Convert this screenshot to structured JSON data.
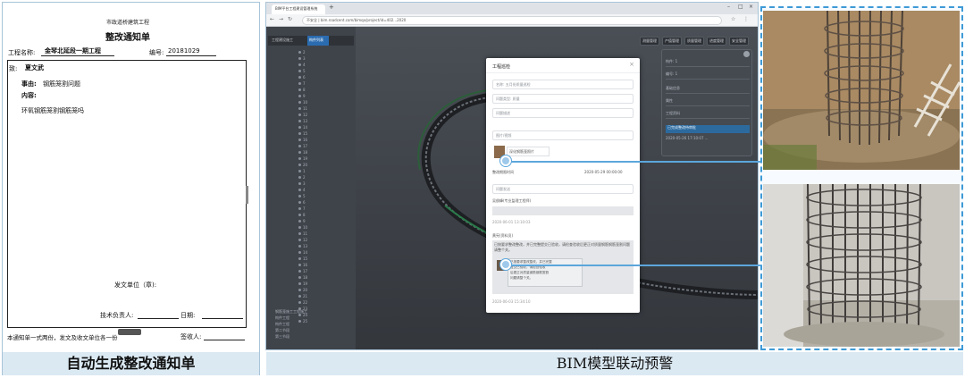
{
  "notice": {
    "header_small": "市政道桥建筑工程",
    "title": "整改通知单",
    "project_label": "工程名称:",
    "project_name": "金琴北延段一期工程",
    "number_label": "编号:",
    "number_value": "20181029",
    "to_label": "致:",
    "to_value": "夏文武",
    "reason_label": "事由:",
    "reason_value": "钢筋笼割问题",
    "content_label": "内容:",
    "content_value": "环氧钢筋笼割钢筋笼吗",
    "issuer_label": "发文单位（章):",
    "tech_label": "技术负责人:",
    "date_label": "日期:",
    "footer_note": "本通知单一式两份，发文及收文单位各一份",
    "receiver_label": "签收人:",
    "caption": "自动生成整改通知单"
  },
  "screenshot": {
    "browser_tab": "BIM平台工程建设管理系统",
    "url": "不安全 | bim.roadcent.com/bimqx/project/id=402...2020",
    "sidebar_header_a": "工程建设施工",
    "sidebar_header_b": "构件列表",
    "tree_items": [
      "2",
      "3",
      "4",
      "5",
      "6",
      "7",
      "8",
      "9",
      "10",
      "11",
      "12",
      "13",
      "14",
      "15",
      "16",
      "17",
      "18",
      "19",
      "20",
      "1",
      "2",
      "3",
      "4",
      "5",
      "6",
      "7",
      "8",
      "9",
      "10",
      "11",
      "12",
      "13",
      "14",
      "15",
      "16",
      "17",
      "18",
      "19",
      "20",
      "21",
      "22",
      "23",
      "24",
      "25"
    ],
    "tree_footer": [
      "钢筋笼施工工程施工",
      "构件工程",
      "构件工程",
      "第二节段",
      "第三节段"
    ],
    "top_buttons": [
      "测量管理",
      "产值管理",
      "质量管理",
      "进度管理",
      "安全管理"
    ],
    "modal": {
      "title": "工程巡检",
      "close": "×",
      "fields": [
        "名称: 五月份质量巡检",
        "问题类型: 质量",
        "问题描述"
      ],
      "images_label": "图片/视频",
      "image_caption": "深化钢筋笼照片",
      "deadline_label": "整改期限时间",
      "deadline_value": "2020-05-29 00:00:00",
      "notify_label": "问题发送",
      "assignee": "吴俊峰(专业监理工程师)",
      "reply_label": "回复内容",
      "time1": "2020-06-01 13:10:03",
      "reply_person": "黄宪(资料员)",
      "reply_text": "已按要求整改整改，并已完整提交已验收，请检查验收后更正对质量钢筋钢筋笼割问题请整个关。",
      "reply_lines": [
        "已按要求整改整改，并已完整",
        "提交已验收，请检查验收",
        "后更正对质量钢筋钢筋笼割",
        "问题请整个关。"
      ],
      "time2": "2020-06-03 15:34:10"
    },
    "right_panel": {
      "rows": [
        "构件: 1",
        "编号: 1",
        "基础信息",
        "属性",
        "工程资料",
        "2020-05-26 17:10:07 ..."
      ],
      "active_row": "已完成整改待审批"
    },
    "caption": "BIM模型联动预警"
  },
  "colors": {
    "caption_bg": "#dbe9f3",
    "accent": "#3e9ad6",
    "viewport": "#3c4046",
    "connector": "#5ca6dc"
  }
}
